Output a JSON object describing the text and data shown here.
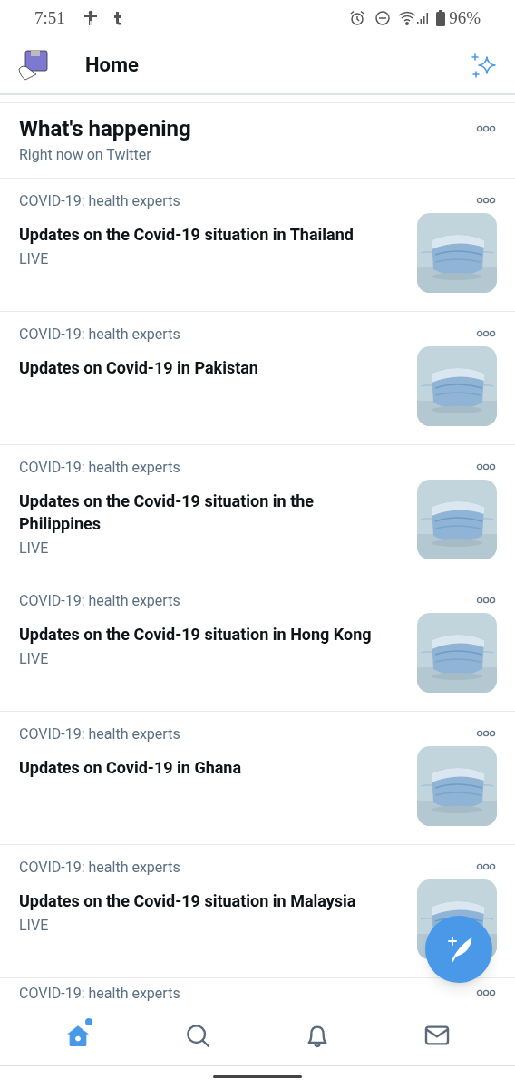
{
  "status_bar": {
    "time": "7:51",
    "battery": "96%"
  },
  "header": {
    "title": "Home"
  },
  "section": {
    "title": "What's happening",
    "subtitle": "Right now on Twitter"
  },
  "trends": [
    {
      "category": "COVID-19: health experts",
      "title": "Updates on the Covid-19 situation in Thailand",
      "badge": "LIVE",
      "kind": "picture"
    },
    {
      "category": "COVID-19: health experts",
      "title": "Updates on Covid-19 in Pakistan",
      "kind": "picture"
    },
    {
      "category": "COVID-19: health experts",
      "title": "Updates on the Covid-19 situation in the Philippines",
      "badge": "LIVE",
      "kind": "picture"
    },
    {
      "category": "COVID-19: health experts",
      "title": "Updates on the Covid-19 situation in Hong Kong",
      "badge": "LIVE",
      "kind": "picture"
    },
    {
      "category": "COVID-19: health experts",
      "title": "Updates on Covid-19 in Ghana",
      "kind": "picture"
    },
    {
      "category": "COVID-19: health experts",
      "title": "Updates on the Covid-19 situation in Malaysia",
      "badge": "LIVE",
      "kind": "picture"
    },
    {
      "category": "COVID-19: health experts"
    }
  ],
  "nav": [
    {
      "kind": "home",
      "selected": true,
      "dot": true
    },
    {
      "kind": "search",
      "selected": false,
      "dot": false
    },
    {
      "kind": "bell",
      "selected": false,
      "dot": false
    },
    {
      "kind": "mail",
      "selected": false,
      "dot": false
    }
  ]
}
